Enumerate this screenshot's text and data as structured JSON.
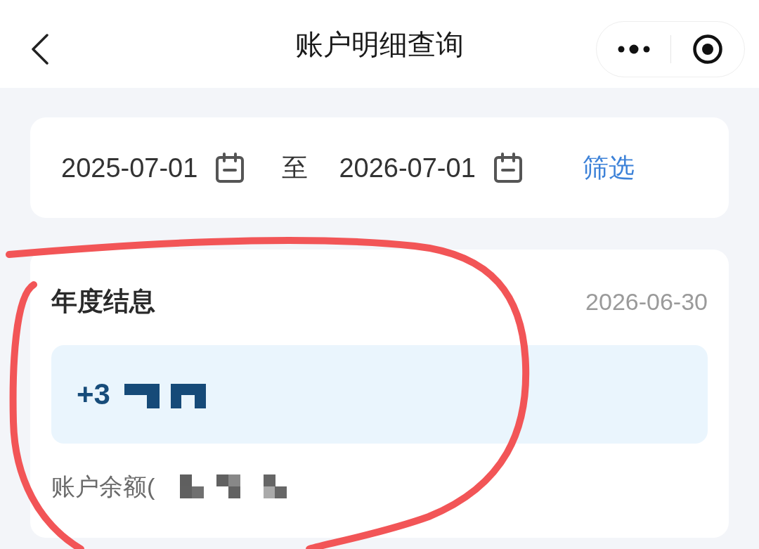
{
  "header": {
    "title": "账户明细查询"
  },
  "date_filter": {
    "start_date": "2025-07-01",
    "separator": "至",
    "end_date": "2026-07-01",
    "filter_button": "筛选"
  },
  "interest_card": {
    "title": "年度结息",
    "date": "2026-06-30",
    "amount": "+3",
    "balance_label": "账户余额("
  }
}
